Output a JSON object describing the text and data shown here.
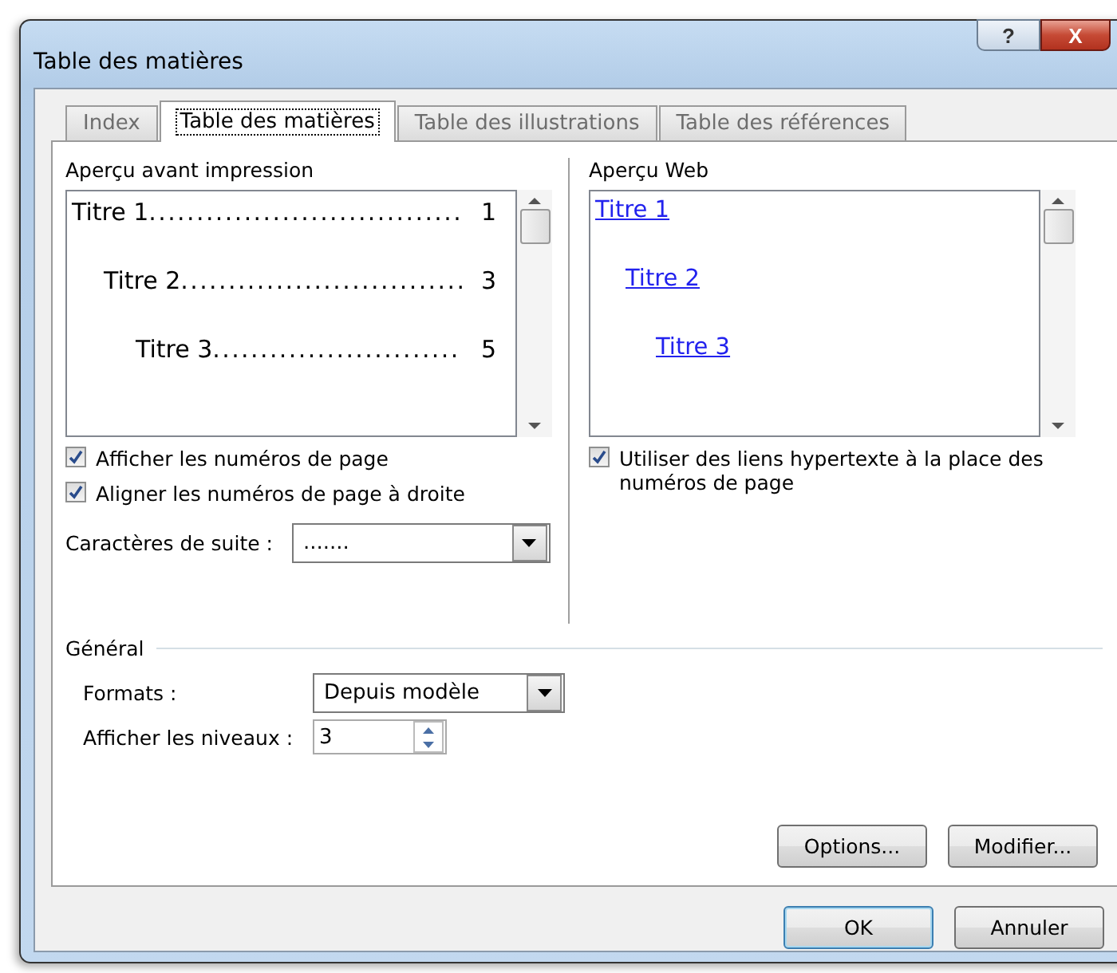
{
  "window": {
    "title": "Table des matières",
    "help_button": "?",
    "close_button": "X"
  },
  "tabs": [
    {
      "label": "Index",
      "selected": false
    },
    {
      "label": "Table des matières",
      "selected": true
    },
    {
      "label": "Table des illustrations",
      "selected": false
    },
    {
      "label": "Table des références",
      "selected": false
    }
  ],
  "print_preview": {
    "label": "Aperçu avant impression",
    "entries": [
      {
        "title": "Titre 1",
        "leader": ".................................",
        "page": "1",
        "children": [
          {
            "title": "Titre 2",
            "leader": "..............................",
            "page": "3",
            "children": [
              {
                "title": "Titre 3",
                "leader": "..........................",
                "page": "5"
              }
            ]
          }
        ]
      }
    ]
  },
  "web_preview": {
    "label": "Aperçu Web",
    "entries": [
      {
        "title": "Titre 1",
        "children": [
          {
            "title": "Titre 2",
            "children": [
              {
                "title": "Titre 3"
              }
            ]
          }
        ]
      }
    ]
  },
  "left_options": [
    {
      "label": "Afficher les numéros de page",
      "checked": true
    },
    {
      "label": "Aligner les numéros de page à droite",
      "checked": true
    }
  ],
  "tab_leader": {
    "label": "Caractères de suite :",
    "value": "......."
  },
  "web_options": [
    {
      "label": "Utiliser des liens hypertexte à la place des numéros de page",
      "checked": true
    }
  ],
  "general": {
    "label": "Général",
    "formats": {
      "label": "Formats :",
      "value": "Depuis modèle"
    },
    "levels": {
      "label": "Afficher les niveaux :",
      "value": "3"
    }
  },
  "panel_buttons": [
    "Options...",
    "Modifier..."
  ],
  "buttons": [
    {
      "label": "OK",
      "selected": true
    },
    {
      "label": "Annuler",
      "selected": false
    }
  ]
}
